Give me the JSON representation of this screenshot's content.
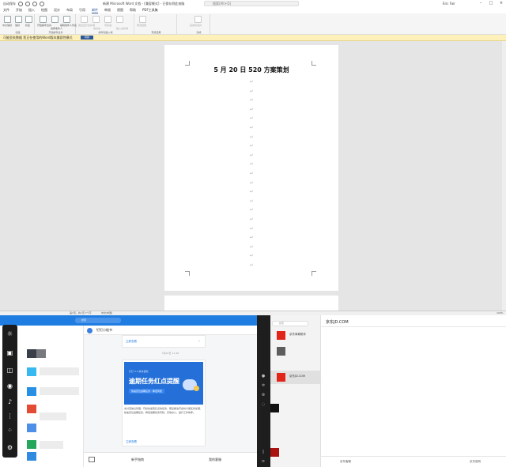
{
  "word": {
    "autosave": "自动保存",
    "doc_title": "新建 Microsoft Word 文档 - [兼容模式] - 已保存到此电脑",
    "search_placeholder": "搜索(Alt+Q)",
    "user_name": "Eric Fair",
    "tabs": [
      "文件",
      "开始",
      "插入",
      "绘图",
      "设计",
      "布局",
      "引用",
      "邮件",
      "审阅",
      "视图",
      "帮助",
      "PDF工具集"
    ],
    "active_tab": "邮件",
    "ribbon": {
      "groups": [
        {
          "label": "创建",
          "buttons": [
            "中文信封",
            "信封",
            "标签"
          ]
        },
        {
          "label": "开始邮件合并",
          "buttons": [
            "开始邮件合并",
            "选择收件人",
            "编辑收件人列表"
          ]
        },
        {
          "label": "编写和插入域",
          "buttons": [
            "突出显示合并域",
            "地址块",
            "问候语",
            "插入合并域"
          ]
        },
        {
          "label": "预览结果",
          "buttons": [
            "预览结果"
          ]
        },
        {
          "label": "完成",
          "buttons": [
            "完成并合并"
          ]
        }
      ]
    },
    "notice": {
      "text": "可能丢失数据 您正在使用的Word版本兼容性模式",
      "button": "转换"
    },
    "document": {
      "heading": "5 月 20 日 520 方案策划",
      "para_mark": "↵",
      "empty_paragraph_count": 21
    },
    "status": {
      "left": "第1页，共1页  7个字",
      "lang": "中文(中国)",
      "zoom": "100%"
    }
  },
  "chat": {
    "search_placeholder": "搜索",
    "contact_name": "钉钉小秘书",
    "card1_link": "立即查看",
    "timestamp": "5月20日 11:48",
    "banner_small": "钉钉 5.0 版本更新",
    "banner_big": "逾期任务红点提醒",
    "banner_sub": "快速定位逾期任务 · 降低风险",
    "body_text": "支付宝信息管理，巧妙的发现红点的任务，帮您解决开会时大量任务处理，快速定位逾期任务，降低逾期任务风险，高效办公，提升工作效率。",
    "card2_link": "立即查看",
    "bottom_left": "新手指南",
    "bottom_right": "我的客服"
  },
  "jd": {
    "search_placeholder": "搜索",
    "items": [
      "京东商城助手",
      "京东JD.COM"
    ],
    "title": "京东JD.COM",
    "bottom_left": "京东客服",
    "bottom_right": "京东官网"
  },
  "colors": {
    "word_accent": "#2b579a",
    "chat_header": "#1f7de2",
    "banner": "#2470d8",
    "notice_bg": "#fdf0b8",
    "jd_red": "#e1251b"
  }
}
